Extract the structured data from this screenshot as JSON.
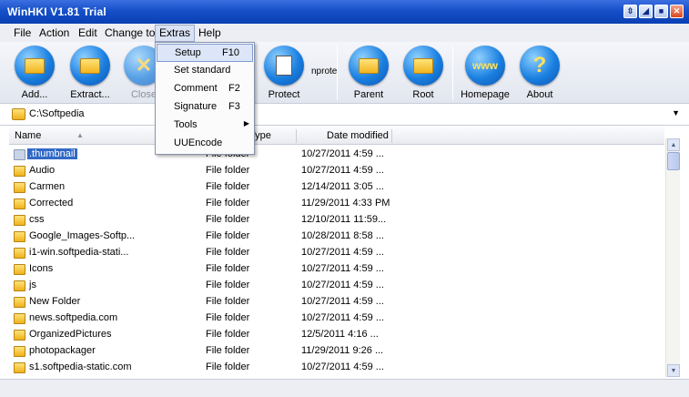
{
  "window": {
    "title": "WinHKI V1.81 Trial",
    "buttons": [
      "⇳",
      "◢",
      "■",
      "✕"
    ]
  },
  "menu": {
    "items": [
      "File",
      "Action",
      "Edit",
      "Change to",
      "Extras",
      "Help"
    ],
    "active": "Extras"
  },
  "extras_menu": {
    "items": [
      {
        "label": "Setup",
        "shortcut": "F10"
      },
      {
        "label": "Set standard",
        "shortcut": ""
      },
      {
        "label": "Comment",
        "shortcut": "F2"
      },
      {
        "label": "Signature",
        "shortcut": "F3"
      },
      {
        "label": "Tools",
        "shortcut": ""
      },
      {
        "label": "UUEncode",
        "shortcut": ""
      }
    ]
  },
  "toolbar": {
    "add": "Add...",
    "extract": "Extract...",
    "close": "Close",
    "protect": "Protect",
    "protect_partial": "nprote",
    "parent": "Parent",
    "root": "Root",
    "homepage": "Homepage",
    "homepage_glyph": "www",
    "about": "About",
    "about_glyph": "?"
  },
  "path": {
    "value": "C:\\Softpedia"
  },
  "columns": {
    "name": "Name",
    "type": "Type",
    "modified": "Date modified"
  },
  "files": [
    {
      "name": ".thumbnail",
      "type": "File folder",
      "modified": "10/27/2011 4:59 ..."
    },
    {
      "name": "Audio",
      "type": "File folder",
      "modified": "10/27/2011 4:59 ..."
    },
    {
      "name": "Carmen",
      "type": "File folder",
      "modified": "12/14/2011 3:05 ..."
    },
    {
      "name": "Corrected",
      "type": "File folder",
      "modified": "11/29/2011 4:33 PM"
    },
    {
      "name": "css",
      "type": "File folder",
      "modified": "12/10/2011 11:59..."
    },
    {
      "name": "Google_Images-Softp...",
      "type": "File folder",
      "modified": "10/28/2011 8:58 ..."
    },
    {
      "name": "i1-win.softpedia-stati...",
      "type": "File folder",
      "modified": "10/27/2011 4:59 ..."
    },
    {
      "name": "Icons",
      "type": "File folder",
      "modified": "10/27/2011 4:59 ..."
    },
    {
      "name": "js",
      "type": "File folder",
      "modified": "10/27/2011 4:59 ..."
    },
    {
      "name": "New Folder",
      "type": "File folder",
      "modified": "10/27/2011 4:59 ..."
    },
    {
      "name": "news.softpedia.com",
      "type": "File folder",
      "modified": "10/27/2011 4:59 ..."
    },
    {
      "name": "OrganizedPictures",
      "type": "File folder",
      "modified": "12/5/2011 4:16 ..."
    },
    {
      "name": "photopackager",
      "type": "File folder",
      "modified": "11/29/2011 9:26 ..."
    },
    {
      "name": "s1.softpedia-static.com",
      "type": "File folder",
      "modified": "10/27/2011 4:59 ..."
    }
  ],
  "colors": {
    "titlebar": "#1650c8",
    "selection": "#3169c6",
    "menu_highlight": "#dce6f8"
  }
}
